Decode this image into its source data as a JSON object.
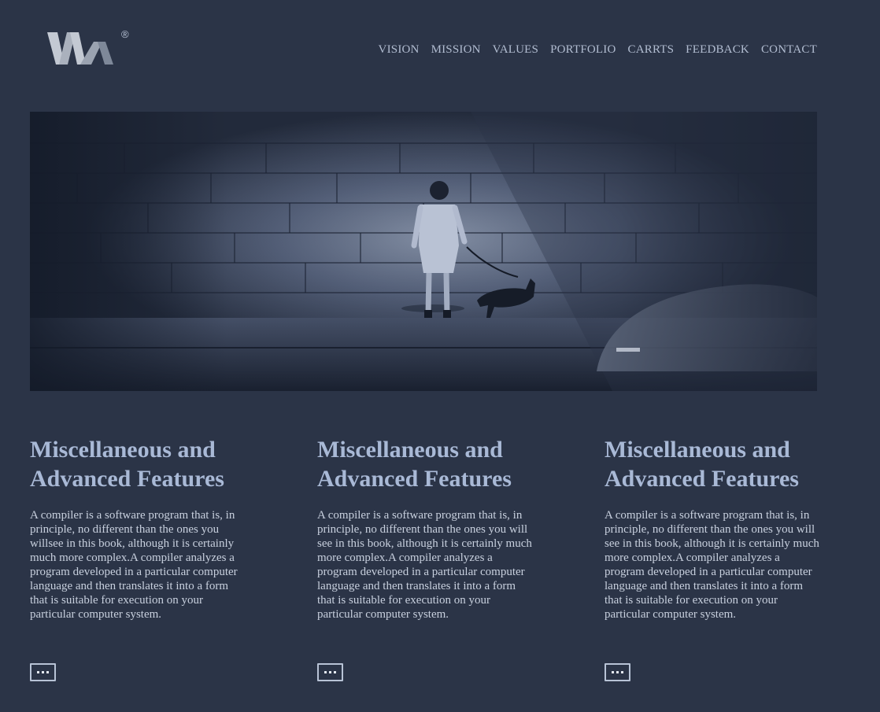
{
  "brand": {
    "logo_icon": "wa-logo-icon",
    "registered_mark": "®"
  },
  "nav": [
    {
      "label": "VISION"
    },
    {
      "label": "MISSION"
    },
    {
      "label": "VALUES"
    },
    {
      "label": "PORTFOLIO"
    },
    {
      "label": "CARRTS"
    },
    {
      "label": "FEEDBACK"
    },
    {
      "label": "CONTACT"
    }
  ],
  "hero": {
    "image": "hero-image",
    "accent": "#2b3447"
  },
  "features": [
    {
      "title": "Miscellaneous and Advanced Features",
      "body": "A compiler is a software program that is, in principle, no different than the ones you willsee in this book, although it is certainly much more complex.A compiler analyzes a program developed in a particular computer language and then translates it into a form that is suitable for execution on your particular computer system.",
      "more_icon": "more-dots-icon"
    },
    {
      "title": "Miscellaneous and Advanced Features",
      "body": "A compiler is a software program that is, in principle, no different than the ones you will see in this book, although it is certainly much more complex.A compiler analyzes a program developed in a particular computer language and then translates it into a form that is suitable for execution on your particular computer system.",
      "more_icon": "more-dots-icon"
    },
    {
      "title": "Miscellaneous and Advanced Features",
      "body": "A compiler is a software program that is, in principle, no different than the ones you will see in this book, although it is certainly much more complex.A compiler analyzes a program developed in a particular computer language and then translates it into a form that is suitable for execution on your particular computer system.",
      "more_icon": "more-dots-icon"
    }
  ],
  "colors": {
    "background": "#2b3447",
    "heading": "#a9b9d6",
    "text": "#c8d0de",
    "nav": "#b2bdd1"
  }
}
